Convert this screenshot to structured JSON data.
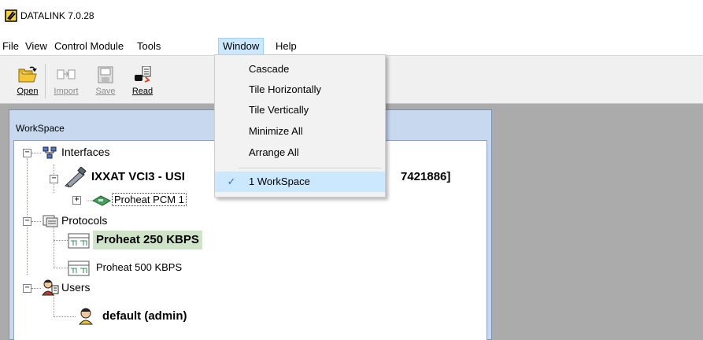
{
  "app": {
    "title": "DATALINK 7.0.28"
  },
  "menu": [
    "File",
    "View",
    "Control Module",
    "Tools",
    "Window",
    "Help"
  ],
  "toolbar": {
    "open": "Open",
    "import": "Import",
    "save": "Save",
    "read": "Read"
  },
  "workspace": {
    "title": "WorkSpace",
    "interfaces": "Interfaces",
    "ixxat_left": "IXXAT VCI3 - USI",
    "ixxat_right": "7421886]",
    "pcm": "Proheat PCM 1",
    "protocols": "Protocols",
    "protocol_250": "Proheat 250 KBPS",
    "protocol_500": "Proheat 500 KBPS",
    "users": "Users",
    "default_user": "default (admin)"
  },
  "window_menu": {
    "cascade": "Cascade",
    "tile_h": "Tile Horizontally",
    "tile_v": "Tile Vertically",
    "minimize_all": "Minimize All",
    "arrange_all": "Arrange All",
    "workspace_item": "1 WorkSpace",
    "check": "✓"
  },
  "colors": {
    "menu_active": "#cce8ff",
    "selected_protocol": "#cfe3c9",
    "mdi_background": "#ababab",
    "workspace_frame": "#c8d8ee"
  }
}
